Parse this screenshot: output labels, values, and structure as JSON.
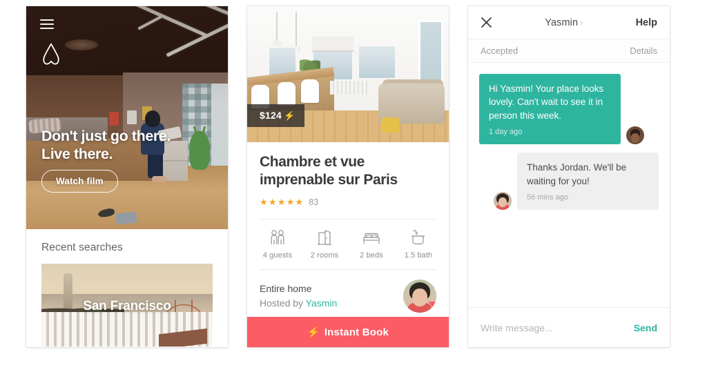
{
  "home": {
    "menu_icon": "hamburger-menu-icon",
    "logo": "airbnb-belo-logo",
    "headline_line1": "Don't just go there.",
    "headline_line2": "Live there.",
    "watch_film_label": "Watch film",
    "recent_searches_title": "Recent searches",
    "recent_searches": [
      {
        "label": "San Francisco"
      },
      {
        "label": ""
      }
    ]
  },
  "listing": {
    "price": "$124",
    "instant_bolt": "⚡",
    "title_line1": "Chambre et vue",
    "title_line2": "imprenable sur Paris",
    "stars": "★★★★★",
    "review_count": "83",
    "amenities": [
      {
        "icon": "guests-icon",
        "label": "4 guests"
      },
      {
        "icon": "rooms-door-icon",
        "label": "2 rooms"
      },
      {
        "icon": "beds-icon",
        "label": "2 beds"
      },
      {
        "icon": "bath-icon",
        "label": "1.5 bath"
      }
    ],
    "host_type": "Entire home",
    "hosted_by_prefix": "Hosted by ",
    "host_name": "Yasmin",
    "instant_book_label": "Instant Book",
    "instant_book_bolt": "⚡"
  },
  "chat": {
    "close_icon": "close-x-icon",
    "peer_name": "Yasmin",
    "peer_chevron": "›",
    "help_label": "Help",
    "status": "Accepted",
    "details_label": "Details",
    "messages": [
      {
        "sender": "Jordan",
        "direction": "out",
        "text": "Hi Yasmin! Your place looks lovely. Can't wait to see it in person this week.",
        "time": "1 day ago"
      },
      {
        "sender": "Yasmin",
        "direction": "in",
        "text": "Thanks Jordan. We'll be waiting for you!",
        "time": "56 mins ago"
      }
    ],
    "input_placeholder": "Write message...",
    "input_value": "",
    "send_label": "Send"
  },
  "colors": {
    "teal": "#2eb5a0",
    "coral": "#fc5c63",
    "star_gold": "#f5a623",
    "badge_bolt": "#ffb400"
  }
}
